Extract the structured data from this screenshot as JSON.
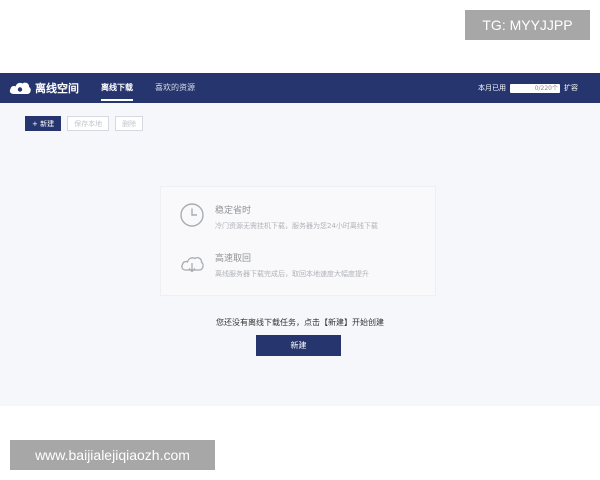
{
  "watermarks": {
    "top_right": "TG: MYYJJPP",
    "bottom_left": "www.baijialejiqiaozh.com"
  },
  "header": {
    "brand_title": "离线空间",
    "brand_icon": "cloud-icon",
    "tabs": [
      {
        "label": "离线下载",
        "active": true
      },
      {
        "label": "喜欢的资源",
        "active": false
      }
    ],
    "quota": {
      "label": "本月已用",
      "value": "0/220个",
      "expand": "扩容"
    }
  },
  "toolbar": {
    "new_label": "+ 新建",
    "buttons": [
      "保存本地",
      "删除"
    ]
  },
  "features": [
    {
      "icon": "clock-icon",
      "title": "稳定省时",
      "desc": "冷门资源无需挂机下载，服务器为您24小时离线下载"
    },
    {
      "icon": "cloud-download-icon",
      "title": "高速取回",
      "desc": "离线服务器下载完成后，取回本地速度大幅度提升"
    }
  ],
  "empty_state": {
    "message": "您还没有离线下载任务，点击【新建】开始创建",
    "button_label": "新建"
  },
  "colors": {
    "primary": "#26356d",
    "background": "#f6f7fa"
  }
}
